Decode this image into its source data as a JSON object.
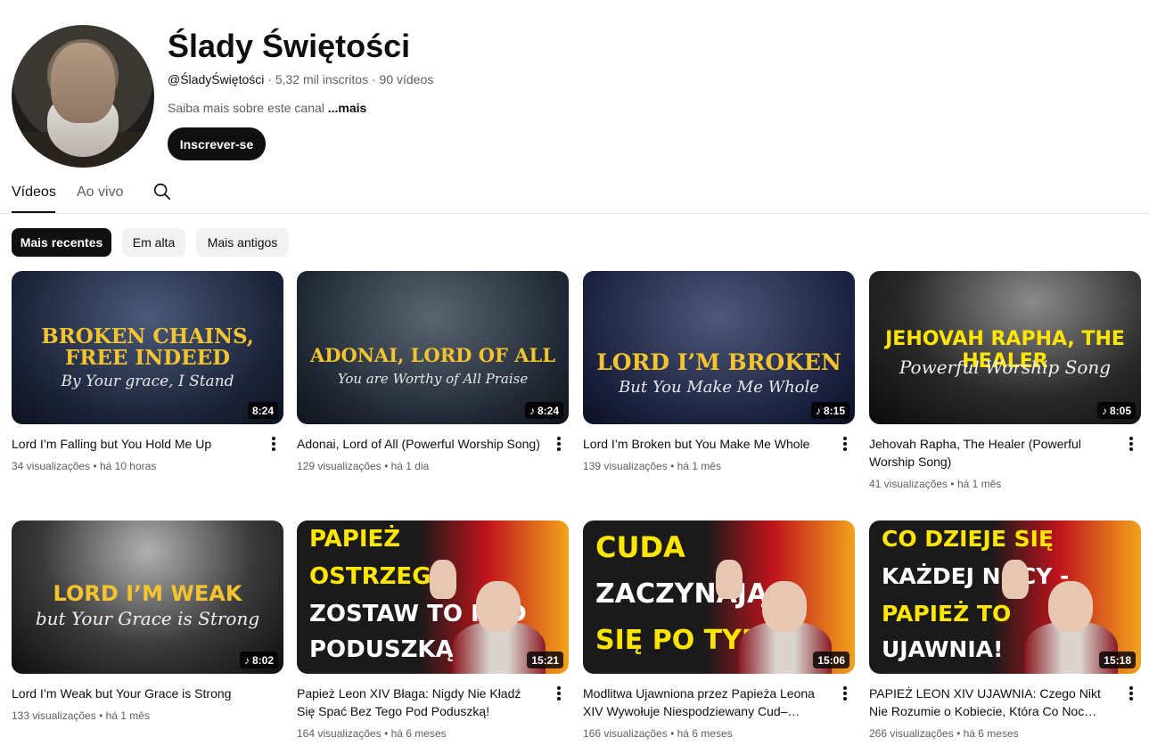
{
  "channel": {
    "name": "Ślady Świętości",
    "handle": "@ŚladyŚwiętości",
    "subscribers": "5,32 mil inscritos",
    "videos_count": "90 vídeos",
    "separator": " · ",
    "about": "Saiba mais sobre este canal ",
    "about_more": "...mais",
    "subscribe_label": "Inscrever-se"
  },
  "tabs": [
    {
      "label": "Vídeos",
      "active": true
    },
    {
      "label": "Ao vivo",
      "active": false
    }
  ],
  "chips": [
    {
      "label": "Mais recentes",
      "active": true
    },
    {
      "label": "Em alta",
      "active": false
    },
    {
      "label": "Mais antigos",
      "active": false
    }
  ],
  "videos": [
    {
      "title": "Lord I’m Falling but You Hold Me Up",
      "views": "34 visualizações",
      "age": "há 10 horas",
      "duration": "8:24",
      "music_icon": false,
      "thumb_line1": "BROKEN CHAINS,",
      "thumb_line2": "FREE INDEED",
      "thumb_sub": "By Your grace, I Stand"
    },
    {
      "title": "Adonai, Lord of All (Powerful Worship Song)",
      "views": "129 visualizações",
      "age": "há 1 dia",
      "duration": "8:24",
      "music_icon": true,
      "thumb_line1": "ADONAI, LORD OF ALL",
      "thumb_line2": "",
      "thumb_sub": "You are Worthy of All Praise"
    },
    {
      "title": "Lord I’m Broken but You Make Me Whole",
      "views": "139 visualizações",
      "age": "há 1 mês",
      "duration": "8:15",
      "music_icon": true,
      "thumb_line1": "LORD I’M BROKEN",
      "thumb_line2": "",
      "thumb_sub": "But You Make Me Whole"
    },
    {
      "title": "Jehovah Rapha, The Healer (Powerful Worship Song)",
      "views": "41 visualizações",
      "age": "há 1 mês",
      "duration": "8:05",
      "music_icon": true,
      "thumb_line1": "JEHOVAH RAPHA, THE HEALER",
      "thumb_line2": "",
      "thumb_sub": "Powerful Worship Song"
    },
    {
      "title": "Lord I’m Weak but Your Grace is Strong",
      "views": "133 visualizações",
      "age": "há 1 mês",
      "duration": "8:02",
      "music_icon": true,
      "thumb_line1": "LORD I’M WEAK",
      "thumb_line2": "",
      "thumb_sub": "but Your Grace is Strong"
    },
    {
      "title": "Papież Leon XIV Błaga: Nigdy Nie Kładź Się Spać Bez Tego Pod Poduszką!",
      "views": "164 visualizações",
      "age": "há 6 meses",
      "duration": "15:21",
      "music_icon": false,
      "thumb_lines": [
        "PAPIEŻ",
        "OSTRZEGA:",
        "ZOSTAW TO POD",
        "PODUSZKĄ"
      ]
    },
    {
      "title": "Modlitwa Ujawniona przez Papieża Leona XIV Wywołuje Niespodziewany Cud–…",
      "views": "166 visualizações",
      "age": "há 6 meses",
      "duration": "15:06",
      "music_icon": false,
      "thumb_lines": [
        "CUDA",
        "ZACZYNAJĄ",
        "SIĘ PO TYM!"
      ]
    },
    {
      "title": "PAPIEŻ LEON XIV UJAWNIA: Czego Nikt Nie Rozumie o Kobiecie, Która Co Noc Śpi…",
      "views": "266 visualizações",
      "age": "há 6 meses",
      "duration": "15:18",
      "music_icon": false,
      "thumb_lines": [
        "CO DZIEJE SIĘ",
        "KAŻDEJ NOCY -",
        "PAPIEŻ TO",
        "UJAWNIA!"
      ]
    }
  ],
  "colors": {
    "text_primary": "#0f0f0f",
    "text_secondary": "#606060",
    "chip_bg": "#f2f2f2",
    "gold": "#f4c430",
    "yellow": "#ffe600"
  }
}
